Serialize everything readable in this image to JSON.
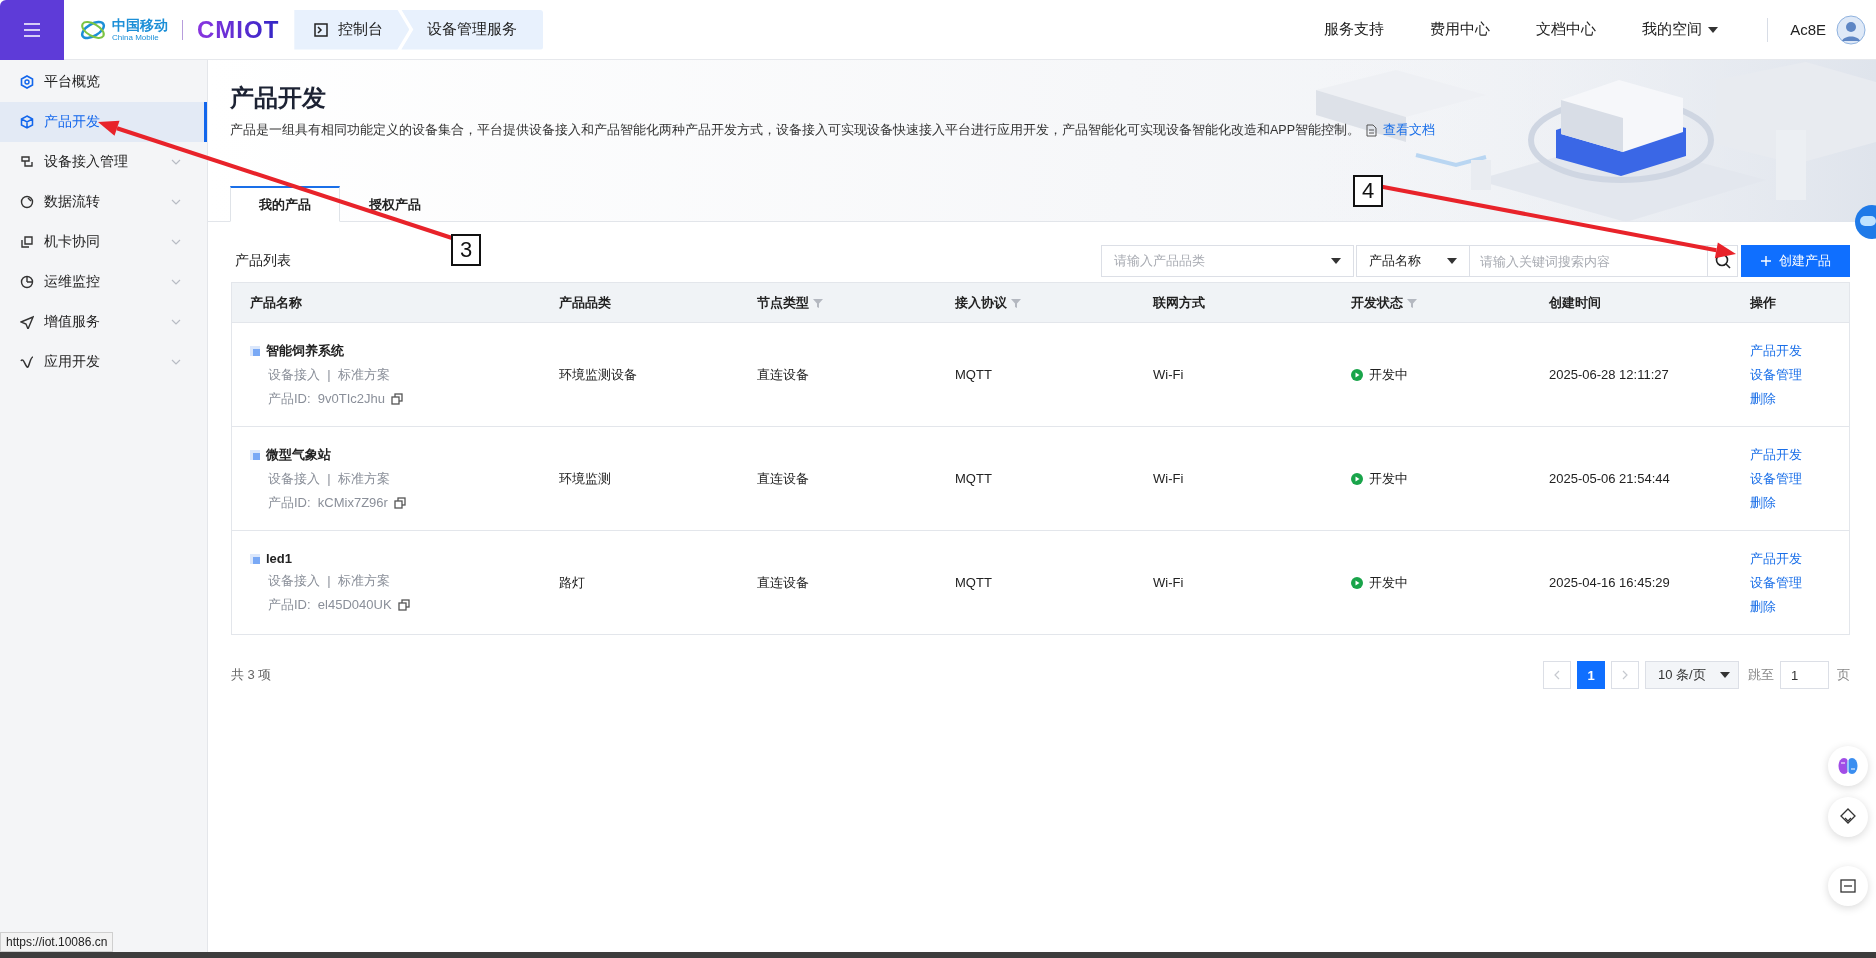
{
  "topbar": {
    "brand_cn": "中国移动",
    "brand_en": "China Mobile",
    "product_logo": "CMIOT",
    "breadcrumb": [
      {
        "label": "控制台",
        "icon": true
      },
      {
        "label": "设备管理服务",
        "icon": false
      }
    ],
    "nav": [
      {
        "label": "服务支持",
        "dropdown": false
      },
      {
        "label": "费用中心",
        "dropdown": false
      },
      {
        "label": "文档中心",
        "dropdown": false
      },
      {
        "label": "我的空间",
        "dropdown": true
      }
    ],
    "user": {
      "name": "Ac8E"
    }
  },
  "sidebar": {
    "items": [
      {
        "label": "平台概览",
        "selected": false,
        "expandable": false
      },
      {
        "label": "产品开发",
        "selected": true,
        "expandable": false
      },
      {
        "label": "设备接入管理",
        "selected": false,
        "expandable": true
      },
      {
        "label": "数据流转",
        "selected": false,
        "expandable": true
      },
      {
        "label": "机卡协同",
        "selected": false,
        "expandable": true
      },
      {
        "label": "运维监控",
        "selected": false,
        "expandable": true
      },
      {
        "label": "增值服务",
        "selected": false,
        "expandable": true
      },
      {
        "label": "应用开发",
        "selected": false,
        "expandable": true
      }
    ]
  },
  "page": {
    "title": "产品开发",
    "description": "产品是一组具有相同功能定义的设备集合，平台提供设备接入和产品智能化两种产品开发方式，设备接入可实现设备快速接入平台进行应用开发，产品智能化可实现设备智能化改造和APP智能控制。",
    "doc_link": "查看文档"
  },
  "tabs": [
    {
      "label": "我的产品",
      "selected": true
    },
    {
      "label": "授权产品",
      "selected": false
    }
  ],
  "list_title": "产品列表",
  "filters": {
    "category": {
      "placeholder": "请输入产品品类"
    },
    "field": {
      "value": "产品名称"
    },
    "search": {
      "placeholder": "请输入关键词搜索内容"
    },
    "create_button": "创建产品"
  },
  "table": {
    "columns": [
      {
        "label": "产品名称",
        "filterable": false
      },
      {
        "label": "产品品类",
        "filterable": false
      },
      {
        "label": "节点类型",
        "filterable": true
      },
      {
        "label": "接入协议",
        "filterable": true
      },
      {
        "label": "联网方式",
        "filterable": false
      },
      {
        "label": "开发状态",
        "filterable": true
      },
      {
        "label": "创建时间",
        "filterable": false
      },
      {
        "label": "操作",
        "filterable": false
      }
    ],
    "rows": [
      {
        "name": "智能饲养系统",
        "meta": "设备接入  |  标准方案",
        "product_id": "产品ID:  9v0TIc2Jhu",
        "category": "环境监测设备",
        "node_type": "直连设备",
        "protocol": "MQTT",
        "network": "Wi-Fi",
        "status": "开发中",
        "created": "2025-06-28 12:11:27",
        "actions": [
          "产品开发",
          "设备管理",
          "删除"
        ]
      },
      {
        "name": "微型气象站",
        "meta": "设备接入  |  标准方案",
        "product_id": "产品ID:  kCMix7Z96r",
        "category": "环境监测",
        "node_type": "直连设备",
        "protocol": "MQTT",
        "network": "Wi-Fi",
        "status": "开发中",
        "created": "2025-05-06 21:54:44",
        "actions": [
          "产品开发",
          "设备管理",
          "删除"
        ]
      },
      {
        "name": "led1",
        "meta": "设备接入  |  标准方案",
        "product_id": "产品ID:  el45D040UK",
        "category": "路灯",
        "node_type": "直连设备",
        "protocol": "MQTT",
        "network": "Wi-Fi",
        "status": "开发中",
        "created": "2025-04-16 16:45:29",
        "actions": [
          "产品开发",
          "设备管理",
          "删除"
        ]
      }
    ]
  },
  "pagination": {
    "total": "共 3 项",
    "prev_disabled": true,
    "next_disabled": true,
    "pages": [
      {
        "label": "1",
        "selected": true
      }
    ],
    "page_size": "10 条/页",
    "jump_label": "跳至",
    "jump_value": "1",
    "page_suffix": "页"
  },
  "annotations": [
    {
      "label": "3"
    },
    {
      "label": "4"
    }
  ],
  "status_url": "https://iot.10086.cn"
}
